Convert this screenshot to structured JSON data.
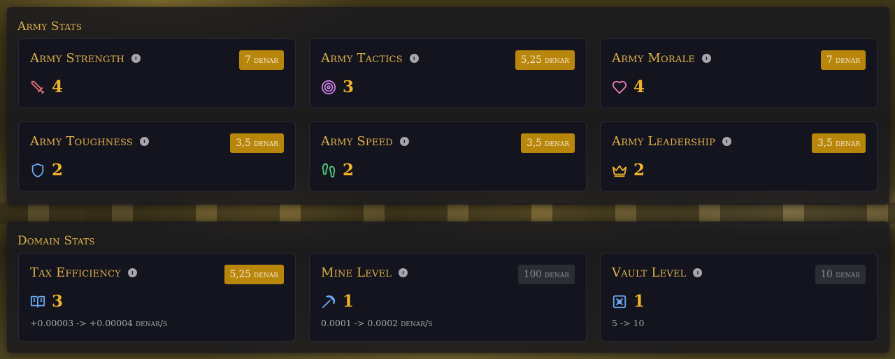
{
  "army": {
    "title": "Army Stats",
    "cards": [
      {
        "name": "Army Strength",
        "cost": "7 denar",
        "value": "4",
        "icon": "sword-icon",
        "color": "#e0707a"
      },
      {
        "name": "Army Tactics",
        "cost": "5,25 denar",
        "value": "3",
        "icon": "target-icon",
        "color": "#c77de0"
      },
      {
        "name": "Army Morale",
        "cost": "7 denar",
        "value": "4",
        "icon": "heart-icon",
        "color": "#ee7ab6"
      },
      {
        "name": "Army Toughness",
        "cost": "3,5 denar",
        "value": "2",
        "icon": "shield-icon",
        "color": "#6aa6ef"
      },
      {
        "name": "Army Speed",
        "cost": "3,5 denar",
        "value": "2",
        "icon": "footprints-icon",
        "color": "#4fcf80"
      },
      {
        "name": "Army Leadership",
        "cost": "3,5 denar",
        "value": "2",
        "icon": "crown-icon",
        "color": "#f0b429"
      }
    ]
  },
  "domain": {
    "title": "Domain Stats",
    "cards": [
      {
        "name": "Tax Efficiency",
        "cost": "5,25 denar",
        "cost_active": true,
        "value": "3",
        "detail": "+0.00003 -> +0.00004 denar/s",
        "icon": "book-icon",
        "color": "#6aa6ef"
      },
      {
        "name": "Mine Level",
        "cost": "100 denar",
        "cost_active": false,
        "value": "1",
        "detail": "0.0001 -> 0.0002 denar/s",
        "icon": "pickaxe-icon",
        "color": "#6aa6ef"
      },
      {
        "name": "Vault Level",
        "cost": "10 denar",
        "cost_active": false,
        "value": "1",
        "detail": "5 -> 10",
        "icon": "vault-icon",
        "color": "#6aa6ef"
      }
    ]
  },
  "colors": {
    "accent": "#e0b24a",
    "value": "#f0b429",
    "badge": "#b8860b",
    "badge_muted": "#2c2c34"
  }
}
